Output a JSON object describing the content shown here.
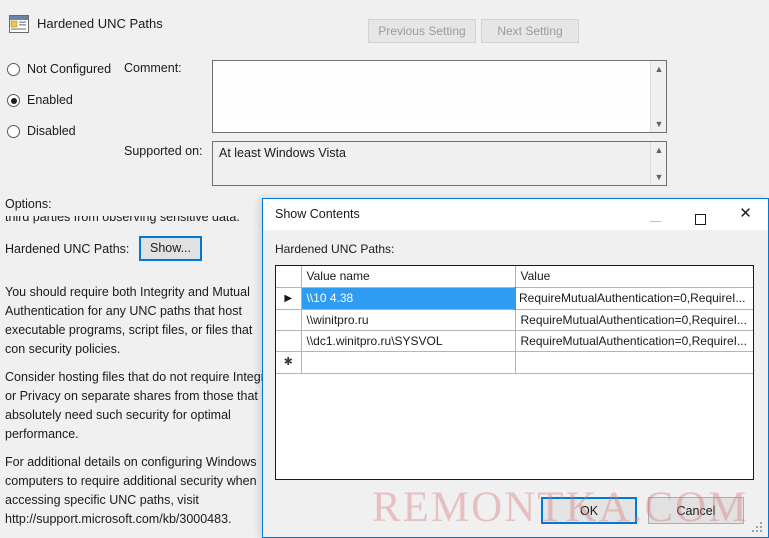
{
  "window": {
    "title": "Hardened UNC Paths",
    "icon": "policy-setting-icon",
    "previous_setting_label": "Previous Setting",
    "next_setting_label": "Next Setting"
  },
  "state_options": [
    {
      "label": "Not Configured",
      "selected": false
    },
    {
      "label": "Enabled",
      "selected": true
    },
    {
      "label": "Disabled",
      "selected": false
    }
  ],
  "fields": {
    "comment_label": "Comment:",
    "comment_value": "",
    "supported_on_label": "Supported on:",
    "supported_on_value": "At least Windows Vista"
  },
  "options": {
    "section_label": "Options:",
    "clipped_text": "third parties from observing sensitive data.",
    "hardened_paths_label": "Hardened UNC Paths:",
    "show_button_label": "Show...",
    "help_paragraphs": [
      "You should require both Integrity and Mutual Authentication for any UNC paths that host executable programs, script files, or files that con security policies.",
      "Consider hosting files that do not require Integrit or Privacy on separate shares from those that absolutely need such security for optimal performance.",
      "For additional details on configuring Windows computers to require additional security when accessing specific UNC paths, visit http://support.microsoft.com/kb/3000483."
    ]
  },
  "dialog": {
    "title": "Show Contents",
    "minimize_glyph": "—",
    "maximize_glyph": "□",
    "close_glyph": "✕",
    "list_label": "Hardened UNC Paths:",
    "columns": [
      "",
      "Value name",
      "Value"
    ],
    "rows": [
      {
        "indicator": "▶",
        "name": "\\\\10    4.38",
        "value": "RequireMutualAuthentication=0,RequireI...",
        "selected": true
      },
      {
        "indicator": "",
        "name": "\\\\winitpro.ru",
        "value": "RequireMutualAuthentication=0,RequireI...",
        "selected": false
      },
      {
        "indicator": "",
        "name": "\\\\dc1.winitpro.ru\\SYSVOL",
        "value": "RequireMutualAuthentication=0,RequireI...",
        "selected": false
      },
      {
        "indicator": "✱",
        "name": "",
        "value": "",
        "selected": false
      }
    ],
    "ok_label": "OK",
    "cancel_label": "Cancel"
  },
  "watermark": {
    "text": "REMONTKA.COM"
  },
  "colors": {
    "accent": "#0078d7",
    "selection": "#2e9cf1",
    "window_bg": "#f0f0f0",
    "watermark": "#d67878"
  }
}
